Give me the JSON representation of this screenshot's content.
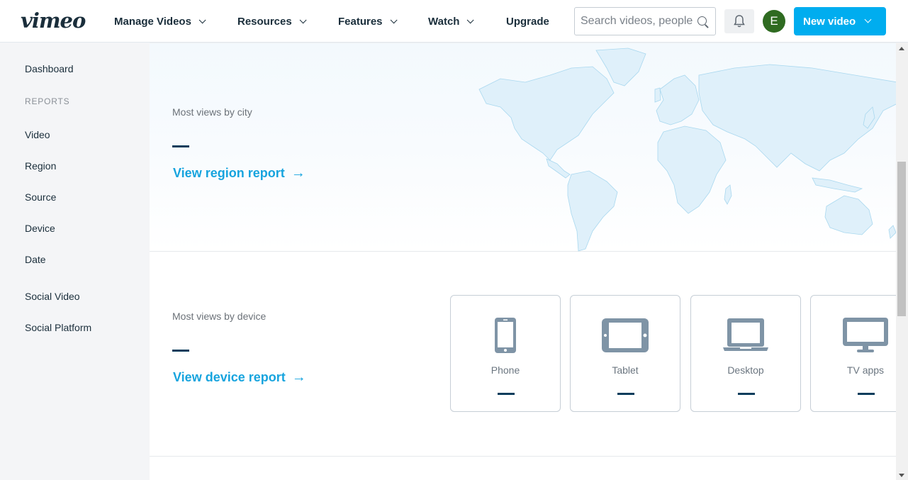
{
  "header": {
    "logo": "vimeo",
    "nav": [
      {
        "label": "Manage Videos",
        "dropdown": true
      },
      {
        "label": "Resources",
        "dropdown": true
      },
      {
        "label": "Features",
        "dropdown": true
      },
      {
        "label": "Watch",
        "dropdown": true
      },
      {
        "label": "Upgrade",
        "dropdown": false
      }
    ],
    "search": {
      "placeholder": "Search videos, people",
      "value": "",
      "icon": "search-icon"
    },
    "notifications_icon": "bell-icon",
    "avatar_initial": "E",
    "new_video_label": "New video",
    "colors": {
      "brand_blue": "#00adef",
      "avatar_green": "#2f6b21",
      "text_dark": "#1a2e3b"
    }
  },
  "sidebar": {
    "dashboard": "Dashboard",
    "reports_heading": "REPORTS",
    "items": [
      "Video",
      "Region",
      "Source",
      "Device",
      "Date",
      "Social Video",
      "Social Platform"
    ]
  },
  "region_section": {
    "label": "Most views by city",
    "value": "—",
    "link": "View region report",
    "link_arrow": "→",
    "map": "world-map"
  },
  "device_section": {
    "label": "Most views by device",
    "value": "—",
    "link": "View device report",
    "link_arrow": "→",
    "devices": [
      {
        "name": "Phone",
        "icon": "phone-icon",
        "value": "—"
      },
      {
        "name": "Tablet",
        "icon": "tablet-icon",
        "value": "—"
      },
      {
        "name": "Desktop",
        "icon": "laptop-icon",
        "value": "—"
      },
      {
        "name": "TV apps",
        "icon": "tv-icon",
        "value": "—"
      }
    ]
  }
}
